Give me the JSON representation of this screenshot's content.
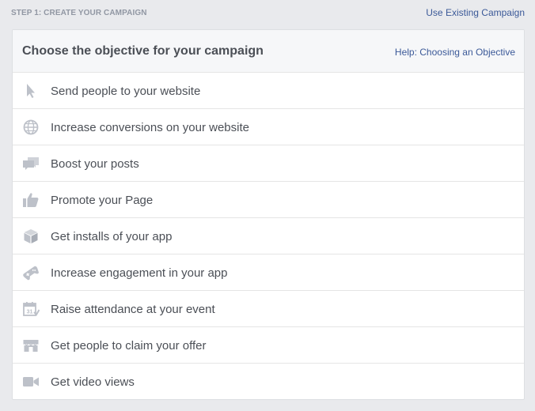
{
  "header": {
    "step_label": "STEP 1: CREATE YOUR CAMPAIGN",
    "use_existing_link": "Use Existing Campaign"
  },
  "panel": {
    "title": "Choose the objective for your campaign",
    "help_link": "Help: Choosing an Objective"
  },
  "objectives": [
    {
      "label": "Send people to your website",
      "icon": "cursor-icon"
    },
    {
      "label": "Increase conversions on your website",
      "icon": "globe-icon"
    },
    {
      "label": "Boost your posts",
      "icon": "speech-bubbles-icon"
    },
    {
      "label": "Promote your Page",
      "icon": "thumbs-up-icon"
    },
    {
      "label": "Get installs of your app",
      "icon": "box-icon"
    },
    {
      "label": "Increase engagement in your app",
      "icon": "gamepad-icon"
    },
    {
      "label": "Raise attendance at your event",
      "icon": "calendar-icon"
    },
    {
      "label": "Get people to claim your offer",
      "icon": "storefront-icon"
    },
    {
      "label": "Get video views",
      "icon": "video-camera-icon"
    }
  ],
  "colors": {
    "background": "#e9eaed",
    "link": "#3b5998",
    "icon": "#bdc1c9",
    "text": "#4b4f56"
  }
}
